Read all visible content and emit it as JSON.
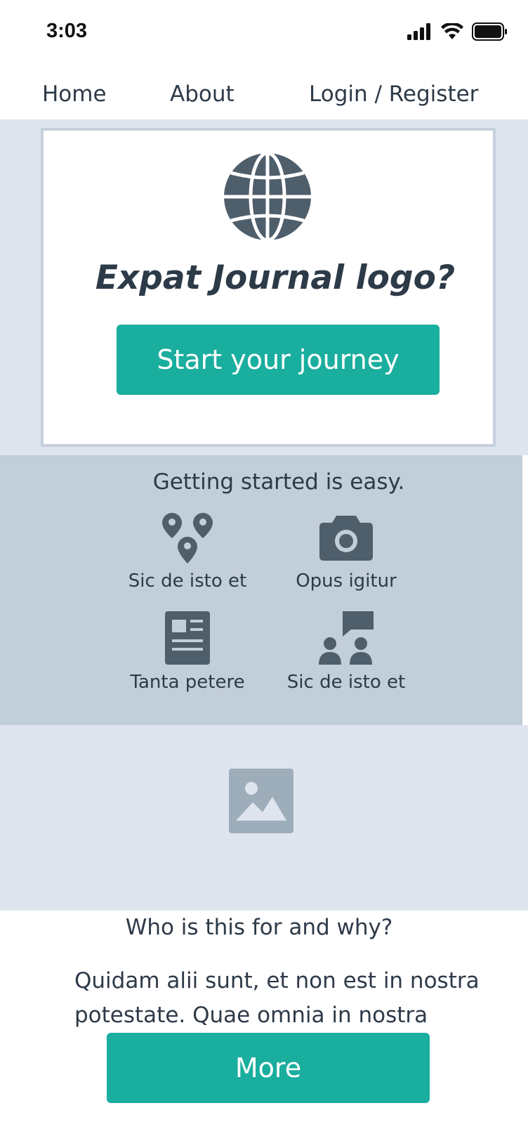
{
  "status": {
    "time": "3:03",
    "icons": [
      "signal-icon",
      "wifi-icon",
      "battery-icon"
    ]
  },
  "nav": {
    "home": "Home",
    "about": "About",
    "login": "Login / Register"
  },
  "hero": {
    "logo_icon": "globe-icon",
    "logo_text": "Expat Journal logo?",
    "cta": "Start your journey"
  },
  "steps": {
    "title": "Getting started is easy.",
    "items": [
      {
        "icon": "map-pins-icon",
        "label": "Sic de isto et"
      },
      {
        "icon": "camera-icon",
        "label": "Opus igitur"
      },
      {
        "icon": "article-icon",
        "label": "Tanta petere"
      },
      {
        "icon": "people-chat-icon",
        "label": "Sic de isto et"
      }
    ]
  },
  "image": {
    "icon": "image-placeholder-icon"
  },
  "who": {
    "title": "Who is this for and why?",
    "body": "Quidam alii sunt, et non est in nostra potestate. Quae omnia in nostra",
    "more": "More"
  },
  "colors": {
    "accent": "#1aae9f",
    "text": "#2d3a48",
    "hero_bg": "#dfe5ee",
    "steps_bg": "#c2ced9",
    "icon": "#4f5e6b",
    "placeholder": "#9eadba"
  }
}
